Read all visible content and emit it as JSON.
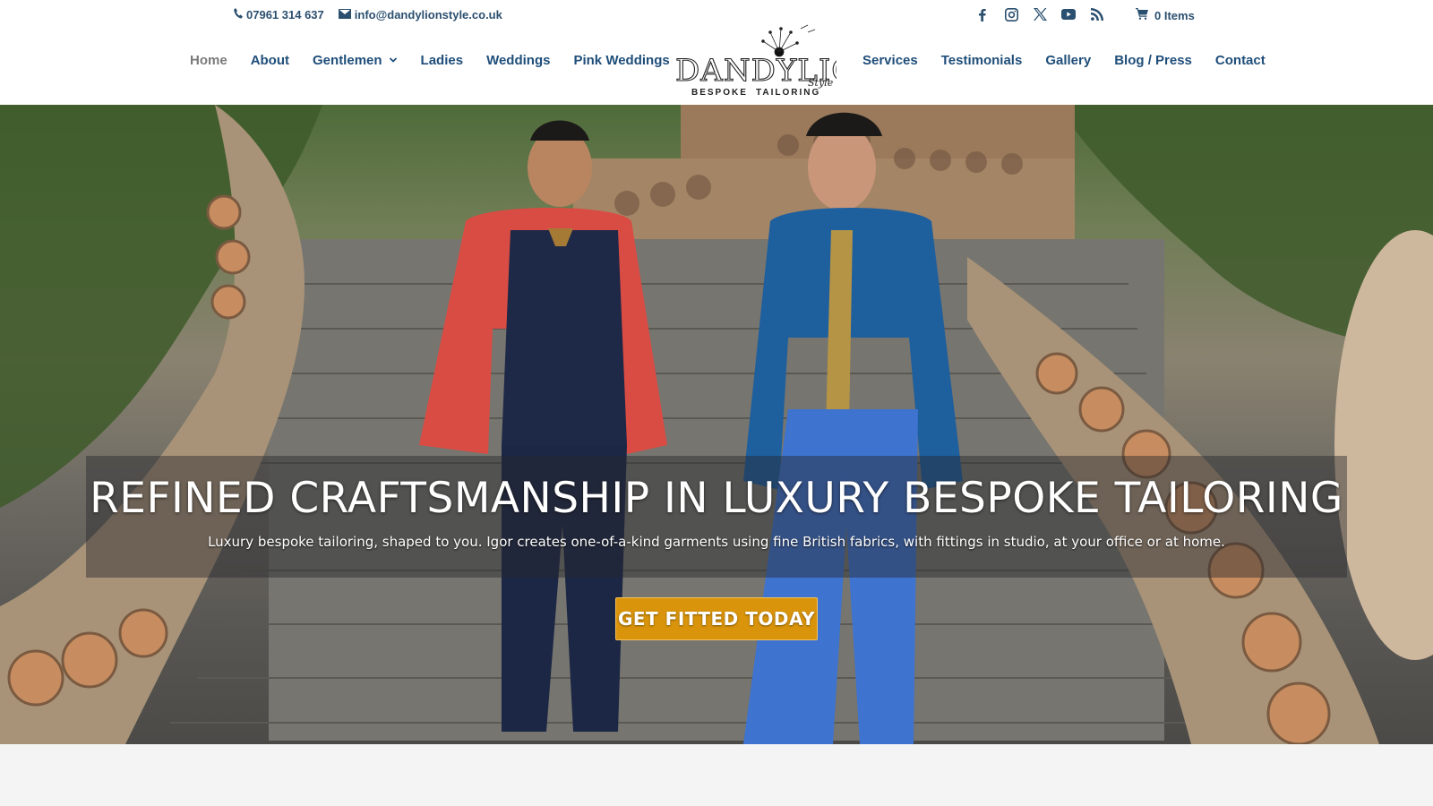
{
  "topbar": {
    "phone": "07961 314 637",
    "email": "info@dandylionstyle.co.uk",
    "socials": [
      "facebook-icon",
      "instagram-icon",
      "x-icon",
      "youtube-icon",
      "rss-icon"
    ],
    "cart_label": "0 Items"
  },
  "nav": {
    "left": [
      {
        "label": "Home",
        "active": true
      },
      {
        "label": "About"
      },
      {
        "label": "Gentlemen",
        "has_dropdown": true
      },
      {
        "label": "Ladies"
      },
      {
        "label": "Weddings"
      },
      {
        "label": "Pink Weddings"
      }
    ],
    "right": [
      {
        "label": "Services"
      },
      {
        "label": "Testimonials"
      },
      {
        "label": "Gallery"
      },
      {
        "label": "Blog / Press"
      },
      {
        "label": "Contact"
      }
    ]
  },
  "logo": {
    "wordmark": "DANDYLION",
    "script": "Style",
    "tagline_left": "BESPOKE",
    "tagline_right": "TAILORING"
  },
  "hero": {
    "title": "REFINED CRAFTSMANSHIP IN LUXURY BESPOKE TAILORING",
    "subtitle": "Luxury bespoke tailoring, shaped to you. Igor creates one-of-a-kind garments using fine British fabrics, with fittings in studio, at your office or at home.",
    "cta_label": "GET FITTED TODAY"
  },
  "colors": {
    "nav_text": "#1f4e7a",
    "nav_active": "#7a7a7a",
    "cta_bg": "#d9940b",
    "footer_strip": "#f4f4f4"
  }
}
